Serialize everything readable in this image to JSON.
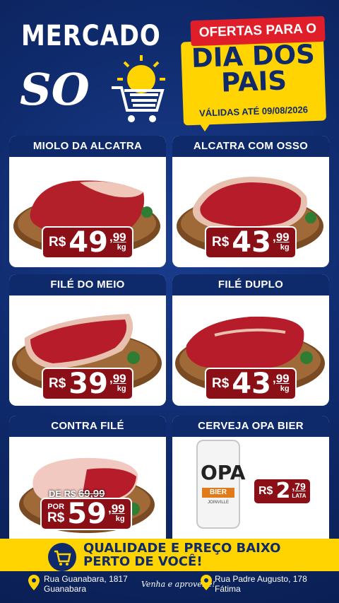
{
  "brand": {
    "line1": "MERCADO",
    "line2": "SOL"
  },
  "promo": {
    "top": "OFERTAS PARA O",
    "title": "DIA DOS PAIS",
    "validity": "VÁLIDAS ATÉ 09/08/2026"
  },
  "products": [
    {
      "name": "MIOLO DA ALCATRA",
      "currency": "R$",
      "int": "49",
      "dec": ",99",
      "unit": "kg"
    },
    {
      "name": "ALCATRA COM OSSO",
      "currency": "R$",
      "int": "43",
      "dec": ",99",
      "unit": "kg"
    },
    {
      "name": "FILÉ DO MEIO",
      "currency": "R$",
      "int": "39",
      "dec": ",99",
      "unit": "kg"
    },
    {
      "name": "FILÉ DUPLO",
      "currency": "R$",
      "int": "43",
      "dec": ",99",
      "unit": "kg"
    },
    {
      "name": "CONTRA FILÉ",
      "old_label": "DE R$",
      "old_price": "69,99",
      "por": "POR",
      "currency": "R$",
      "int": "59",
      "dec": ",99",
      "unit": "kg"
    },
    {
      "name": "CERVEJA OPA BIER",
      "currency": "R$",
      "int": "2",
      "dec": ",79",
      "unit": "LATA",
      "can_brand": "OPA",
      "can_sub": "BIER",
      "can_city": "JOINVILLE"
    }
  ],
  "footer": {
    "tagline1": "QUALIDADE E PREÇO BAIXO",
    "tagline2": "PERTO DE VOCÊ!",
    "slogan": "Venha e aproveite!",
    "address1": {
      "street": "Rua Guanabara, 1817",
      "district": "Guanabara"
    },
    "address2": {
      "street": "Rua Padre Augusto, 178",
      "district": "Fátima"
    }
  },
  "colors": {
    "navy": "#0f2a6b",
    "yellow": "#ffd400",
    "red": "#e01e2a",
    "price_red": "#8b0f16"
  },
  "icons": [
    "sun-icon",
    "cart-icon",
    "location-pin-icon"
  ]
}
